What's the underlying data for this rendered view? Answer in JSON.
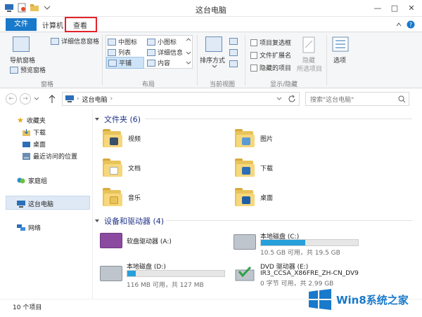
{
  "window": {
    "title": "这台电脑",
    "minimize": "—",
    "maximize": "□",
    "close": "✕"
  },
  "ribbon_tabs": {
    "file": "文件",
    "computer": "计算机",
    "view": "查看"
  },
  "ribbon": {
    "panes": {
      "nav_pane": "导航窗格",
      "preview_pane": "预览窗格",
      "details_pane": "详细信息窗格",
      "group": "窗格"
    },
    "layout": {
      "medium_icons": "中图标",
      "small_icons": "小图标",
      "list": "列表",
      "details": "详细信息",
      "tiles": "平铺",
      "content": "内容",
      "group": "布局"
    },
    "current_view": {
      "sort_by": "排序方式",
      "group": "当前视图"
    },
    "show_hide": {
      "item_checkboxes": "项目复选框",
      "file_extensions": "文件扩展名",
      "hidden_items": "隐藏的项目",
      "hide": "隐藏",
      "selected_items": "所选项目",
      "group": "显示/隐藏"
    },
    "options": "选项"
  },
  "address": {
    "path": "这台电脑",
    "search_placeholder": "搜索\"这台电脑\""
  },
  "nav_pane": {
    "favorites": "收藏夹",
    "downloads": "下载",
    "desktop": "桌面",
    "recent": "最近访问的位置",
    "homegroup": "家庭组",
    "this_pc": "这台电脑",
    "network": "网络"
  },
  "folders_header": "文件夹 (6)",
  "folders": [
    {
      "label": "视频",
      "icon": "video-folder-icon"
    },
    {
      "label": "图片",
      "icon": "pictures-folder-icon"
    },
    {
      "label": "文档",
      "icon": "documents-folder-icon"
    },
    {
      "label": "下载",
      "icon": "downloads-folder-icon"
    },
    {
      "label": "音乐",
      "icon": "music-folder-icon"
    },
    {
      "label": "桌面",
      "icon": "desktop-folder-icon"
    }
  ],
  "devices_header": "设备和驱动器 (4)",
  "drives": [
    {
      "name": "软盘驱动器 (A:)",
      "detail": ""
    },
    {
      "name": "本地磁盘 (C:)",
      "detail": "10.5 GB 可用，共 19.5 GB",
      "used_fraction": 0.46
    },
    {
      "name": "本地磁盘 (D:)",
      "detail": "116 MB 可用，共 127 MB",
      "used_fraction": 0.09
    },
    {
      "name": "DVD 驱动器 (E:)",
      "label2": "IR3_CCSA_X86FRE_ZH-CN_DV9",
      "detail": "0 字节 可用，共 2.99 GB"
    }
  ],
  "status": {
    "count": "10 个项目"
  },
  "watermark": "Win8系统之家",
  "colors": {
    "accent": "#1979ca",
    "highlight_box": "#e3242b",
    "progress": "#26a0da"
  }
}
